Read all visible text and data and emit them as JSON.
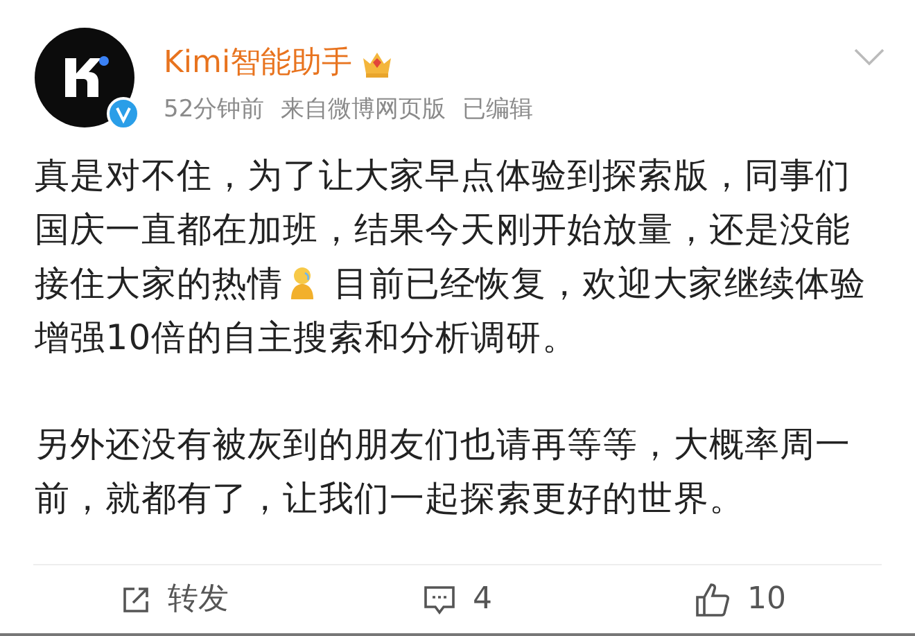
{
  "author": {
    "name": "Kimi智能助手",
    "verified": true
  },
  "meta": {
    "time": "52分钟前",
    "source": "来自微博网页版",
    "edited": "已编辑"
  },
  "paragraphs": [
    {
      "before": "真是对不住，为了让大家早点体验到探索版，同事们国庆一直都在加班，结果今天刚开始放量，还是没能接住大家的热情",
      "after": " 目前已经恢复，欢迎大家继续体验增强10倍的自主搜索和分析调研。"
    },
    {
      "before": "另外还没有被灰到的朋友们也请再等等，大概率周一前，就都有了，让我们一起探索更好的世界。"
    }
  ],
  "actions": [
    {
      "kind": "repost",
      "label": "转发"
    },
    {
      "kind": "comment",
      "label": "4"
    },
    {
      "kind": "like",
      "label": "10"
    }
  ]
}
